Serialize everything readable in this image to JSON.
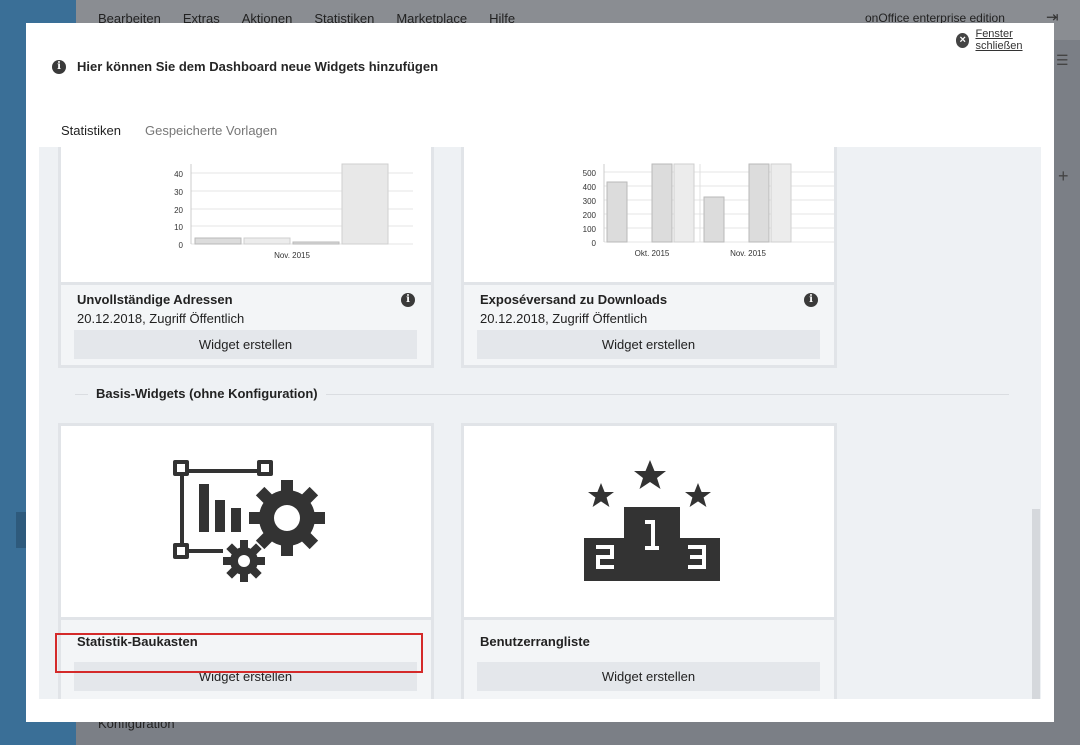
{
  "app": {
    "menu": [
      "Bearbeiten",
      "Extras",
      "Aktionen",
      "Statistiken",
      "Marketplace",
      "Hilfe"
    ],
    "brand": "onOffice enterprise edition",
    "bottom_link": "Konfiguration"
  },
  "modal": {
    "close_label": "Fenster schließen",
    "heading": "Hier können Sie dem Dashboard neue Widgets hinzufügen",
    "tabs": [
      {
        "label": "Statistiken",
        "active": true
      },
      {
        "label": "Gespeicherte Vorlagen",
        "active": false
      }
    ]
  },
  "widgets_top": [
    {
      "title": "Unvollständige Adressen",
      "meta": "20.12.2018, Zugriff Öffentlich",
      "button": "Widget erstellen",
      "chart": {
        "y_ticks": [
          "40",
          "30",
          "20",
          "10",
          "0"
        ],
        "x_label": "Nov. 2015"
      }
    },
    {
      "title": "Exposéversand zu Downloads",
      "meta": "20.12.2018, Zugriff Öffentlich",
      "button": "Widget erstellen",
      "chart": {
        "y_ticks": [
          "500",
          "400",
          "300",
          "200",
          "100",
          "0"
        ],
        "x_labels": [
          "Okt. 2015",
          "Nov. 2015"
        ]
      }
    }
  ],
  "section_title": "Basis-Widgets (ohne Konfiguration)",
  "widgets_basic": [
    {
      "title": "Statistik-Baukasten",
      "button": "Widget erstellen",
      "icon": "chart-gear-icon"
    },
    {
      "title": "Benutzerrangliste",
      "button": "Widget erstellen",
      "icon": "podium-icon"
    }
  ],
  "colors": {
    "accent": "#3b7cc2",
    "highlight": "#d42a2a",
    "icon": "#333333"
  }
}
